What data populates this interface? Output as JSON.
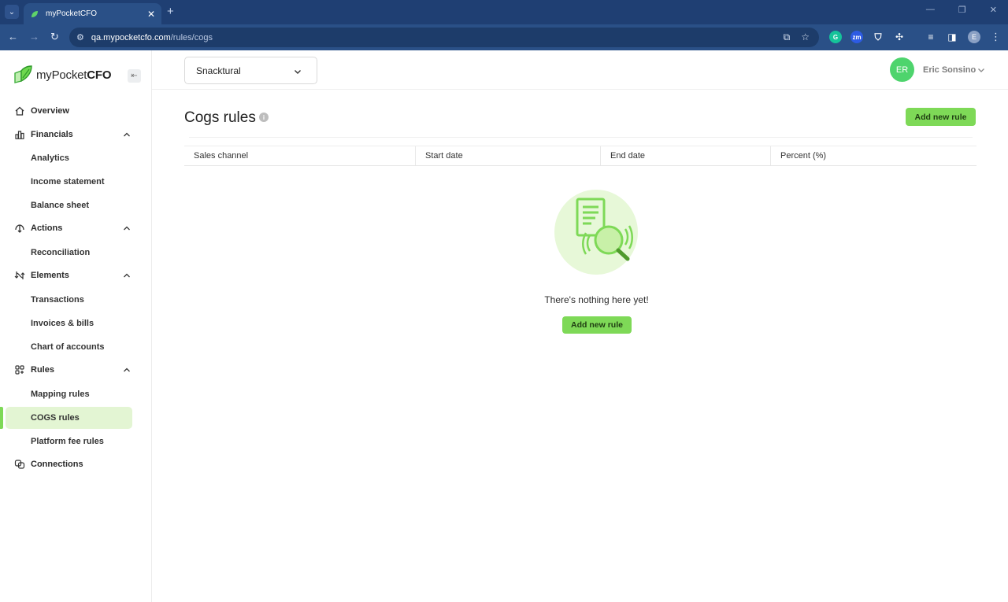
{
  "browser": {
    "tab_title": "myPocketCFO",
    "url_host": "qa.mypocketcfo.com",
    "url_path": "/rules/cogs",
    "profile_initial": "E"
  },
  "colors": {
    "brand_green": "#7ed957",
    "active_bg": "#e3f5d3",
    "avatar": "#4ed46d",
    "browser_chrome": "#2a5087"
  },
  "sidebar": {
    "logo_light": "myPocket",
    "logo_bold": "CFO",
    "items": [
      {
        "label": "Overview",
        "icon": "home-icon"
      },
      {
        "label": "Financials",
        "icon": "bar-chart-icon",
        "expanded": true
      },
      {
        "label": "Analytics"
      },
      {
        "label": "Income statement"
      },
      {
        "label": "Balance sheet"
      },
      {
        "label": "Actions",
        "icon": "actions-icon",
        "expanded": true
      },
      {
        "label": "Reconciliation"
      },
      {
        "label": "Elements",
        "icon": "elements-icon",
        "expanded": true
      },
      {
        "label": "Transactions"
      },
      {
        "label": "Invoices & bills"
      },
      {
        "label": "Chart of accounts"
      },
      {
        "label": "Rules",
        "icon": "rules-icon",
        "expanded": true
      },
      {
        "label": "Mapping rules"
      },
      {
        "label": "COGS rules",
        "active": true
      },
      {
        "label": "Platform fee rules"
      },
      {
        "label": "Connections",
        "icon": "connections-icon"
      }
    ]
  },
  "header": {
    "company": "Snacktural",
    "avatar_initials": "ER",
    "user_name": "Eric Sonsino"
  },
  "page": {
    "title": "Cogs rules",
    "info": "i",
    "add_button": "Add new rule",
    "columns": [
      "Sales channel",
      "Start date",
      "End date",
      "Percent (%)"
    ],
    "empty_text": "There's nothing here yet!",
    "empty_add_button": "Add new rule"
  }
}
